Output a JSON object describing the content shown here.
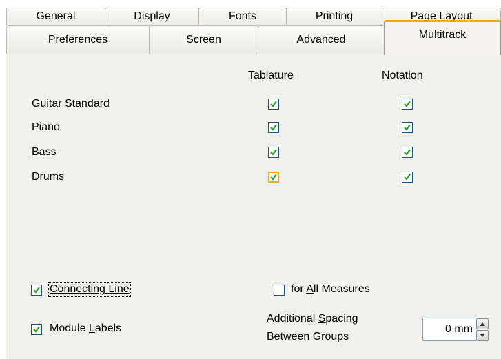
{
  "tabs_back": [
    {
      "label": "General"
    },
    {
      "label": "Display"
    },
    {
      "label": "Fonts"
    },
    {
      "label": "Printing"
    },
    {
      "label": "Page Layout"
    }
  ],
  "tabs_front": [
    {
      "label": "Preferences"
    },
    {
      "label": "Screen"
    },
    {
      "label": "Advanced"
    },
    {
      "label": "Multitrack",
      "selected": true
    }
  ],
  "table": {
    "col_tablature": "Tablature",
    "col_notation": "Notation",
    "rows": [
      {
        "label": "Guitar Standard",
        "tablature": true,
        "notation": true
      },
      {
        "label": "Piano",
        "tablature": true,
        "notation": true
      },
      {
        "label": "Bass",
        "tablature": true,
        "notation": true
      },
      {
        "label": "Drums",
        "tablature": true,
        "notation": true
      }
    ]
  },
  "options": {
    "connecting_line": {
      "label": "Connecting Line",
      "checked": true
    },
    "for_all_measures": {
      "label_prefix": "for ",
      "label_accel": "A",
      "label_rest": "ll Measures",
      "checked": false
    },
    "module_labels": {
      "label_prefix": "Module ",
      "label_accel": "L",
      "label_rest": "abels",
      "checked": true
    },
    "spacing": {
      "label_line1_prefix": "Additional ",
      "label_line1_accel": "S",
      "label_line1_rest": "pacing",
      "label_line2": "Between Groups",
      "value": "0 mm"
    }
  },
  "colors": {
    "check": "#21a121",
    "checkbox_border": "#1c5180",
    "selected_tab_accent": "#f5a623",
    "panel_bg": "#f0f0ec"
  }
}
